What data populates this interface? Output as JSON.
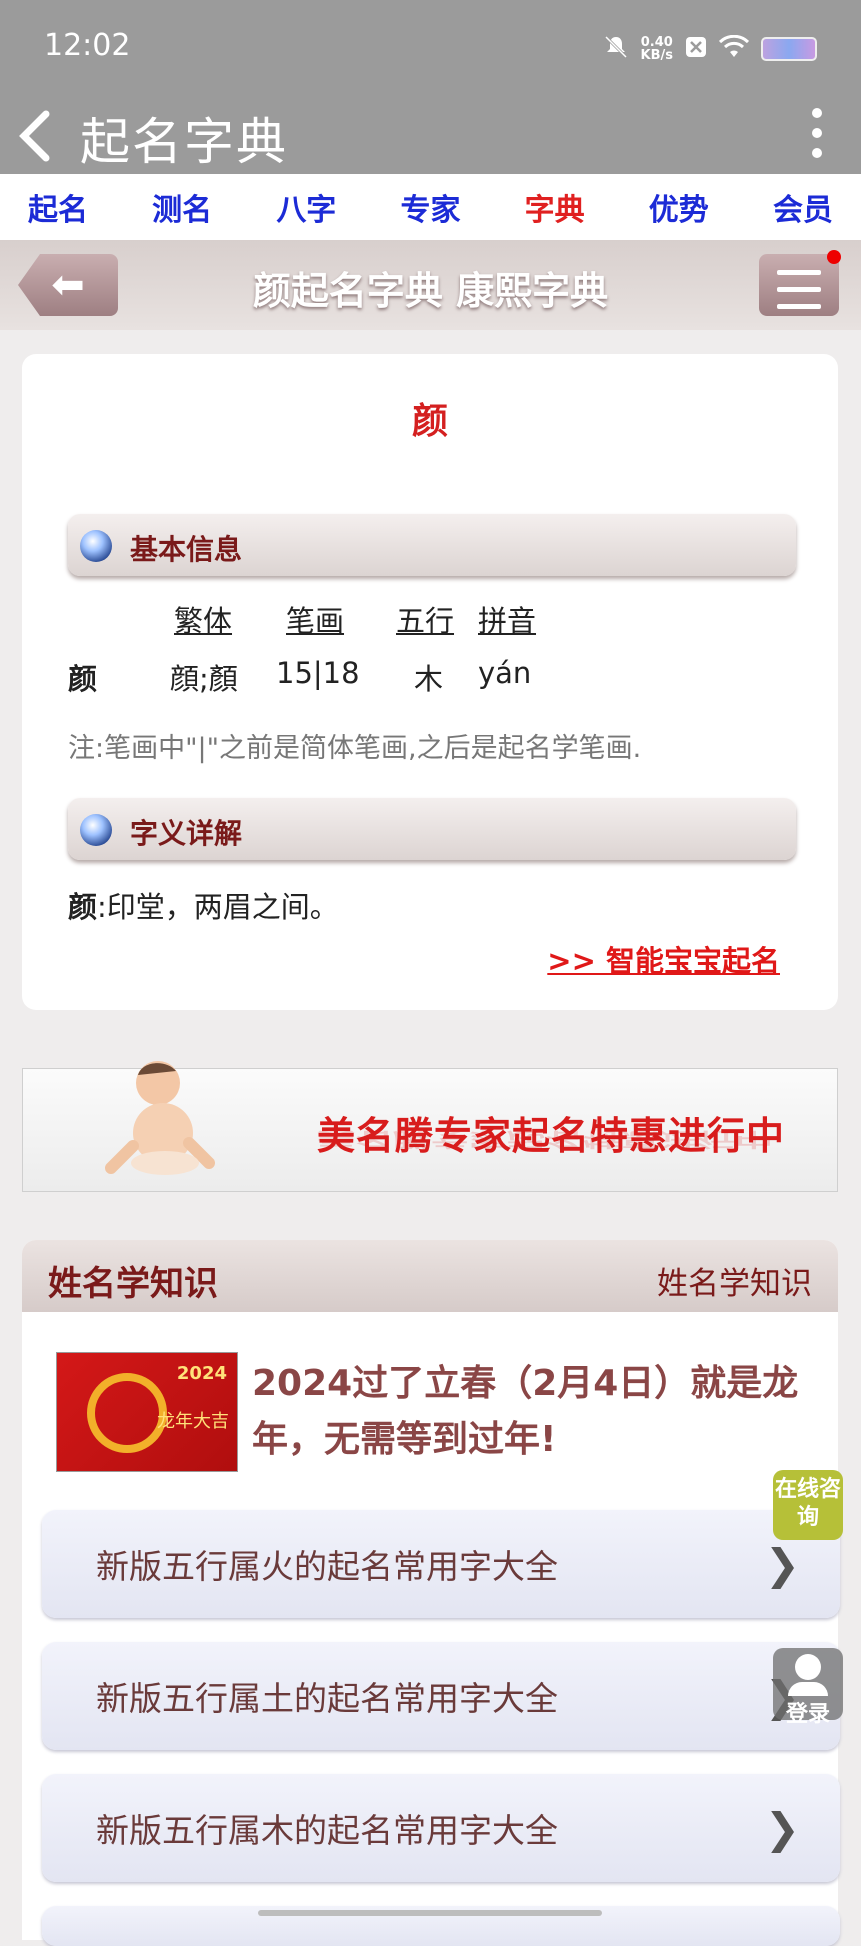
{
  "status": {
    "time": "12:02",
    "net_speed": "0.40",
    "net_unit": "KB/s"
  },
  "appbar": {
    "title": "起名字典"
  },
  "nav": [
    "起名",
    "测名",
    "八字",
    "专家",
    "字典",
    "优势",
    "会员"
  ],
  "nav_active": "字典",
  "titlebar": {
    "title": "颜起名字典 康熙字典"
  },
  "entry": {
    "char": "颜",
    "section_basic": "基本信息",
    "headers": {
      "trad": "繁体",
      "strokes": "笔画",
      "wuxing": "五行",
      "pinyin": "拼音"
    },
    "row": {
      "char": "颜",
      "trad": "顔;顏",
      "strokes": "15|18",
      "wuxing": "木",
      "pinyin": "yán"
    },
    "note": "注:笔画中\"|\"之前是简体笔画,之后是起名学笔画.",
    "section_meaning": "字义详解",
    "meaning_char": "颜",
    "meaning_text": ":印堂，两眉之间。",
    "smart_link": ">> 智能宝宝起名"
  },
  "banner": {
    "text": "美名腾专家起名特惠进行中"
  },
  "knowledge": {
    "title": "姓名学知识",
    "more": "姓名学知识",
    "featured": "2024过了立春（2月4日）就是龙年，无需等到过年!",
    "thumb_year": "2024",
    "thumb_text": "龙年大吉",
    "items": [
      "新版五行属火的起名常用字大全",
      "新版五行属土的起名常用字大全",
      "新版五行属木的起名常用字大全"
    ]
  },
  "floating": {
    "consult": "在线咨询",
    "login": "登录"
  }
}
